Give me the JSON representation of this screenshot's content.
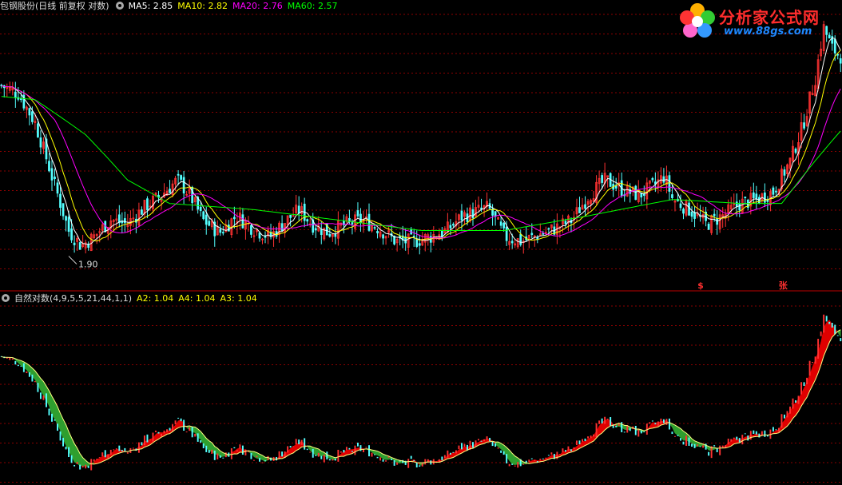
{
  "header": {
    "title": "包钢股份(日线 前复权 对数)",
    "ma5": "MA5: 2.85",
    "ma10": "MA10: 2.82",
    "ma20": "MA20: 2.76",
    "ma60": "MA60: 2.57"
  },
  "indicator_header": {
    "title": "自然对数(4,9,5,5,21,44,1,1)",
    "a2": "A2: 1.04",
    "a4": "A4: 1.04",
    "a3": "A3: 1.04"
  },
  "logo": {
    "name": "分析家公式网",
    "url": "www.88gs.com"
  },
  "colors": {
    "background": "#000000",
    "up": "#ff3232",
    "down": "#54ffff",
    "ma5": "#ffffff",
    "ma10": "#ffff00",
    "ma20": "#ff00ff",
    "ma60": "#00ff00",
    "grid": "#8b0000",
    "fill_up": "#e00000",
    "fill_down": "#2f9f2f"
  },
  "chart_data": {
    "type": "line",
    "scale": "log",
    "low_marker": "1.90",
    "signals": [
      {
        "x": 0.832,
        "label": "$"
      },
      {
        "x": 0.93,
        "label": "张"
      }
    ],
    "price_profile": [
      [
        0,
        2.85
      ],
      [
        0.02,
        2.8
      ],
      [
        0.04,
        2.62
      ],
      [
        0.06,
        2.32
      ],
      [
        0.08,
        2.05
      ],
      [
        0.095,
        1.98
      ],
      [
        0.11,
        2.02
      ],
      [
        0.13,
        2.1
      ],
      [
        0.15,
        2.08
      ],
      [
        0.17,
        2.16
      ],
      [
        0.19,
        2.22
      ],
      [
        0.21,
        2.3
      ],
      [
        0.225,
        2.22
      ],
      [
        0.24,
        2.1
      ],
      [
        0.26,
        2.04
      ],
      [
        0.28,
        2.12
      ],
      [
        0.3,
        2.06
      ],
      [
        0.32,
        2.02
      ],
      [
        0.34,
        2.1
      ],
      [
        0.355,
        2.15
      ],
      [
        0.37,
        2.08
      ],
      [
        0.39,
        2.04
      ],
      [
        0.41,
        2.08
      ],
      [
        0.43,
        2.1
      ],
      [
        0.45,
        2.06
      ],
      [
        0.47,
        2.0
      ],
      [
        0.49,
        2.0
      ],
      [
        0.51,
        2.02
      ],
      [
        0.53,
        2.05
      ],
      [
        0.55,
        2.12
      ],
      [
        0.565,
        2.14
      ],
      [
        0.58,
        2.16
      ],
      [
        0.6,
        2.02
      ],
      [
        0.62,
        2.0
      ],
      [
        0.64,
        2.03
      ],
      [
        0.66,
        2.06
      ],
      [
        0.68,
        2.1
      ],
      [
        0.7,
        2.22
      ],
      [
        0.72,
        2.3
      ],
      [
        0.74,
        2.25
      ],
      [
        0.76,
        2.22
      ],
      [
        0.78,
        2.28
      ],
      [
        0.79,
        2.32
      ],
      [
        0.8,
        2.2
      ],
      [
        0.82,
        2.15
      ],
      [
        0.84,
        2.08
      ],
      [
        0.86,
        2.12
      ],
      [
        0.88,
        2.18
      ],
      [
        0.9,
        2.2
      ],
      [
        0.92,
        2.24
      ],
      [
        0.94,
        2.4
      ],
      [
        0.955,
        2.6
      ],
      [
        0.97,
        2.9
      ],
      [
        0.98,
        3.25
      ],
      [
        0.99,
        3.1
      ],
      [
        1.0,
        3.05
      ]
    ],
    "ma60_profile": [
      [
        0,
        2.78
      ],
      [
        0.04,
        2.76
      ],
      [
        0.1,
        2.55
      ],
      [
        0.15,
        2.3
      ],
      [
        0.2,
        2.18
      ],
      [
        0.3,
        2.15
      ],
      [
        0.4,
        2.1
      ],
      [
        0.5,
        2.05
      ],
      [
        0.6,
        2.05
      ],
      [
        0.7,
        2.12
      ],
      [
        0.8,
        2.2
      ],
      [
        0.88,
        2.18
      ],
      [
        0.93,
        2.18
      ],
      [
        1.0,
        2.57
      ]
    ]
  }
}
